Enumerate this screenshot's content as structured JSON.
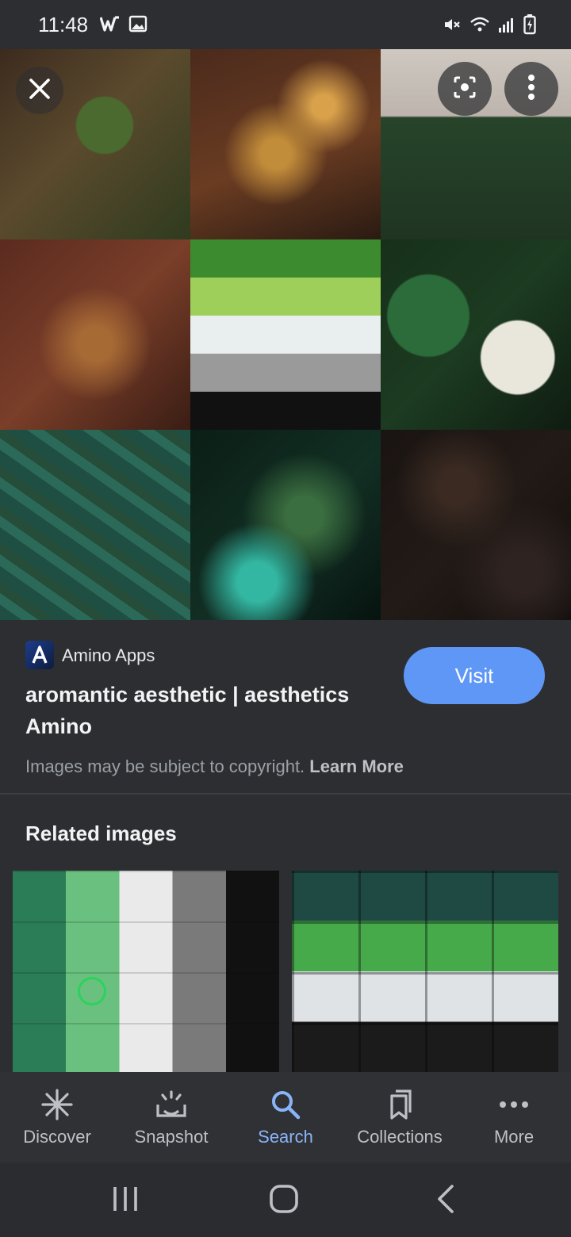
{
  "status_bar": {
    "time": "11:48",
    "left_icons": [
      "w-app-icon",
      "image-icon"
    ],
    "right_icons": [
      "mute-icon",
      "wifi-icon",
      "signal-icon",
      "battery-icon"
    ]
  },
  "hero": {
    "close_icon": "close-icon",
    "lens_icon": "lens-icon",
    "more_icon": "more-vertical-icon"
  },
  "source": {
    "site_name": "Amino Apps",
    "title": "aromantic aesthetic | aesthetics Amino",
    "visit_label": "Visit",
    "copyright_text": "Images may be subject to copyright.",
    "learn_more": "Learn More"
  },
  "related": {
    "heading": "Related images"
  },
  "bottom_nav": {
    "items": [
      {
        "label": "Discover",
        "icon": "asterisk-icon",
        "active": false
      },
      {
        "label": "Snapshot",
        "icon": "snapshot-icon",
        "active": false
      },
      {
        "label": "Search",
        "icon": "search-icon",
        "active": true
      },
      {
        "label": "Collections",
        "icon": "bookmarks-icon",
        "active": false
      },
      {
        "label": "More",
        "icon": "more-horizontal-icon",
        "active": false
      }
    ]
  },
  "colors": {
    "background": "#2d2e31",
    "accent": "#8ab4f8",
    "visit_button": "#5e97f6"
  }
}
